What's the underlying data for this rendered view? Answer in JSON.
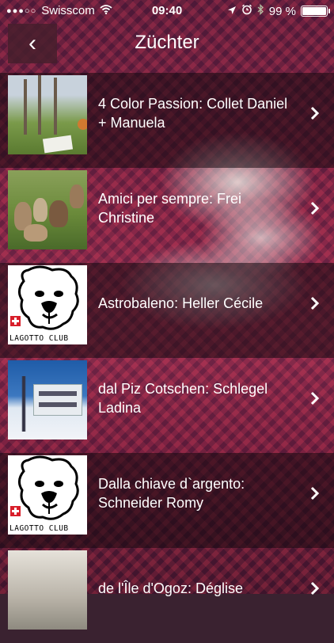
{
  "status_bar": {
    "signal_dots": "●●●○○",
    "carrier": "Swisscom",
    "time": "09:40",
    "battery_percent": "99 %",
    "battery_level": 0.99
  },
  "nav": {
    "back_glyph": "‹",
    "title": "Züchter"
  },
  "breeders": [
    {
      "label": "4 Color Passion: Collet Daniel + Manuela",
      "thumbnail": "garden-photo"
    },
    {
      "label": "Amici per sempre: Frei Christine",
      "thumbnail": "dogs-on-grass-photo"
    },
    {
      "label": "Astrobaleno: Heller Cécile",
      "thumbnail": "lagotto-club-logo"
    },
    {
      "label": "dal Piz Cotschen: Schlegel Ladina",
      "thumbnail": "snowy-building-photo"
    },
    {
      "label": "Dalla chiave d`argento: Schneider Romy",
      "thumbnail": "lagotto-club-logo"
    },
    {
      "label": "de l'Île d'Ogoz: Déglise",
      "thumbnail": "house-photo"
    }
  ],
  "logo_text": "LAGOTTO CLUB",
  "colors": {
    "background": "#3a2230",
    "back_button": "#46202d",
    "text": "#ffffff"
  }
}
